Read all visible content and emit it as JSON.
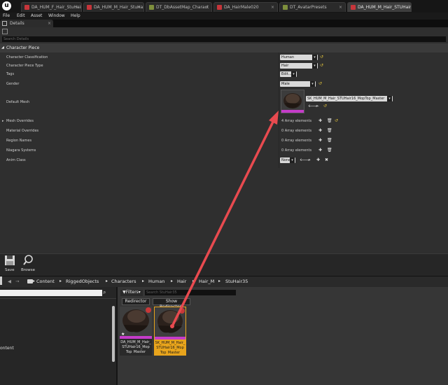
{
  "tabs": [
    {
      "label": "DA_HUM_F_Hair_StuHair0",
      "color": "#c7353a"
    },
    {
      "label": "DA_HUM_M_Hair_StuHairC",
      "color": "#c7353a"
    },
    {
      "label": "DT_DbAssetMap_Charact",
      "color": "#7e8f3c"
    },
    {
      "label": "DA_HairMale020",
      "color": "#c7353a"
    },
    {
      "label": "DT_AvatarPresets",
      "color": "#7e8f3c"
    },
    {
      "label": "DA_HUM_M_Hair_STUHair",
      "color": "#c7353a"
    }
  ],
  "tab_close": "×",
  "app_logo": "u",
  "menu": [
    "File",
    "Edit",
    "Asset",
    "Window",
    "Help"
  ],
  "details_tab": {
    "label": "Details",
    "close": "×"
  },
  "details_search_placeholder": "Search Details",
  "section": {
    "title": "Character Piece"
  },
  "properties": {
    "character_classification": {
      "label": "Character Classification",
      "value": "Human"
    },
    "character_piece_type": {
      "label": "Character Piece Type",
      "value": "Hair"
    },
    "tags": {
      "label": "Tags",
      "value": "Edit..."
    },
    "gender": {
      "label": "Gender",
      "value": "Male"
    },
    "default_mesh": {
      "label": "Default Mesh",
      "value": "SK_HUM_M_Hair_STUHair16_MopTop_Master"
    },
    "mesh_overrides": {
      "label": "Mesh Overrides",
      "value": "4 Array elements"
    },
    "material_overrides": {
      "label": "Material Overrides",
      "value": "0 Array elements"
    },
    "region_names": {
      "label": "Region Names",
      "value": "0 Array elements"
    },
    "niagara_systems": {
      "label": "Niagara Systems",
      "value": "0 Array elements"
    },
    "anim_class": {
      "label": "Anim Class",
      "value": "None"
    }
  },
  "toolbar": {
    "save_label": "Save",
    "browse_label": "Browse"
  },
  "breadcrumbs": [
    "Content",
    "RiggedObjects",
    "Characters",
    "Human",
    "Hair",
    "Hair_M",
    "StuHair35"
  ],
  "left_pane": {
    "folder_label": "ontent"
  },
  "filters_label": "Filters",
  "asset_search_placeholder": "Search StuHair35",
  "chips": {
    "redirector": "Redirector",
    "show_redirectors": "Show Redirectors"
  },
  "assets": [
    {
      "label_line1": "DA_HUM_M_Hair_",
      "label_line2": "STUHair16_Mop",
      "label_line3": "Top_Master",
      "selected": false
    },
    {
      "label_line1": "SK_HUM_M_Hair_",
      "label_line2": "STUHair16_Mop",
      "label_line3": "Top_Master",
      "selected": true
    }
  ],
  "colors": {
    "accent_selected": "#e8a41c",
    "arrow": "#e84a4f",
    "reset_arrow": "#e5c53b"
  }
}
